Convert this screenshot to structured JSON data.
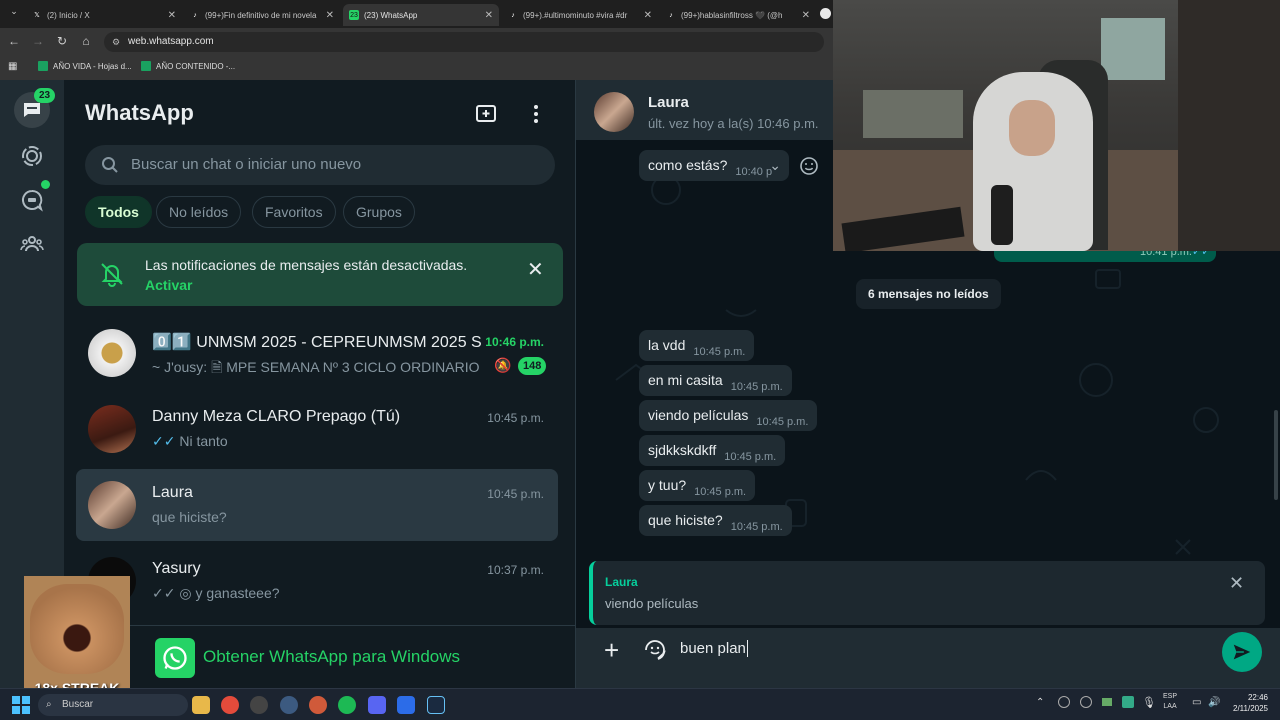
{
  "browser": {
    "tabs": [
      {
        "title": "(2) Inicio / X",
        "favicon": "X"
      },
      {
        "title": "(99+)Fin definitivo de mi novela",
        "favicon": "tiktok"
      },
      {
        "title": "(23) WhatsApp",
        "favicon": "23"
      },
      {
        "title": "(99+).#ultimominuto #vira #dr",
        "favicon": "tiktok"
      },
      {
        "title": "(99+)hablasinfiltross 🖤 (@h",
        "favicon": "tiktok"
      }
    ],
    "url": "web.whatsapp.com",
    "bookmarks": [
      "AÑO VIDA - Hojas d...",
      "AÑO CONTENIDO -..."
    ]
  },
  "rail": {
    "chats_badge": "23"
  },
  "sidebar": {
    "title": "WhatsApp",
    "search_placeholder": "Buscar un chat o iniciar uno nuevo",
    "filters": [
      "Todos",
      "No leídos",
      "Favoritos",
      "Grupos"
    ],
    "notice": {
      "text": "Las notificaciones de mensajes están desactivadas.",
      "action": "Activar"
    },
    "chats": [
      {
        "name": "0️⃣1️⃣ UNMSM 2025 - CEPREUNMSM 2025 S...",
        "time": "10:46 p.m.",
        "preview_sender": "~ J'ousy:",
        "preview": "MPE SEMANA Nº 3  CICLO ORDINARIO ...",
        "unread": "148"
      },
      {
        "name": "Danny Meza CLARO Prepago (Tú)",
        "time": "10:45 p.m.",
        "preview": "Ni tanto"
      },
      {
        "name": "Laura",
        "time": "10:45 p.m.",
        "preview": "que hiciste?"
      },
      {
        "name": "Yasury",
        "time": "10:37 p.m.",
        "preview": "y ganasteee?"
      }
    ],
    "get_app": "Obtener WhatsApp para Windows"
  },
  "conversation": {
    "contact": "Laura",
    "last_seen": "últ. vez hoy a la(s) 10:46 p.m.",
    "top_message": {
      "text": "como estás?",
      "time": "10:40 p"
    },
    "hidden_time": "10:41 p.m.",
    "unread_label": "6 mensajes no leídos",
    "messages": [
      {
        "text": "la vdd",
        "time": "10:45 p.m."
      },
      {
        "text": "en mi casita",
        "time": "10:45 p.m."
      },
      {
        "text": "viendo películas",
        "time": "10:45 p.m."
      },
      {
        "text": "sjdkkskdkff",
        "time": "10:45 p.m."
      },
      {
        "text": "y tuu?",
        "time": "10:45 p.m."
      },
      {
        "text": "que hiciste?",
        "time": "10:45 p.m."
      }
    ],
    "reply": {
      "author": "Laura",
      "text": "viendo películas"
    },
    "composer_value": "buen plan"
  },
  "overlay": {
    "streak": "18x STREAK"
  },
  "taskbar": {
    "search": "Buscar",
    "lang": "ESP",
    "lang2": "LAA",
    "time": "22:46",
    "date": "2/11/2025"
  },
  "colors": {
    "accent": "#00a884",
    "badge": "#25d366",
    "panel": "#202c33",
    "background": "#111b21"
  }
}
